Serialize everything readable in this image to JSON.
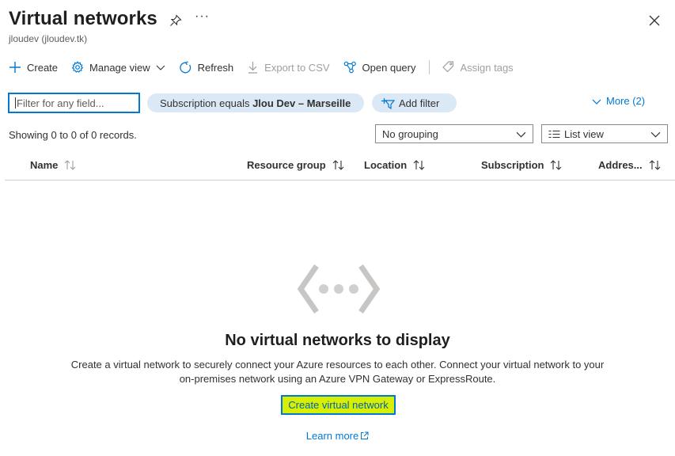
{
  "header": {
    "title": "Virtual networks",
    "subtitle": "jloudev (jloudev.tk)",
    "more_glyph": "···"
  },
  "toolbar": {
    "create": "Create",
    "manage_view": "Manage view",
    "refresh": "Refresh",
    "export_csv": "Export to CSV",
    "open_query": "Open query",
    "assign_tags": "Assign tags"
  },
  "filters": {
    "placeholder": "Filter for any field...",
    "subscription_prefix": "Subscription equals ",
    "subscription_value": "Jlou Dev – Marseille",
    "add_filter": "Add filter",
    "more": "More (2)"
  },
  "list": {
    "records": "Showing 0 to 0 of 0 records.",
    "grouping": "No grouping",
    "view": "List view",
    "columns": [
      "Name",
      "Resource group",
      "Location",
      "Subscription",
      "Addres..."
    ]
  },
  "empty_state": {
    "title": "No virtual networks to display",
    "description_line1": "Create a virtual network to securely connect your Azure resources to each other. Connect your virtual network to your",
    "description_line2": "on-premises network using an Azure VPN Gateway or ExpressRoute.",
    "create_button": "Create virtual network",
    "learn_more": "Learn more"
  },
  "colors": {
    "accent": "#0078d4",
    "pill_bg": "#dbe9f7",
    "highlight": "#d8f000"
  }
}
